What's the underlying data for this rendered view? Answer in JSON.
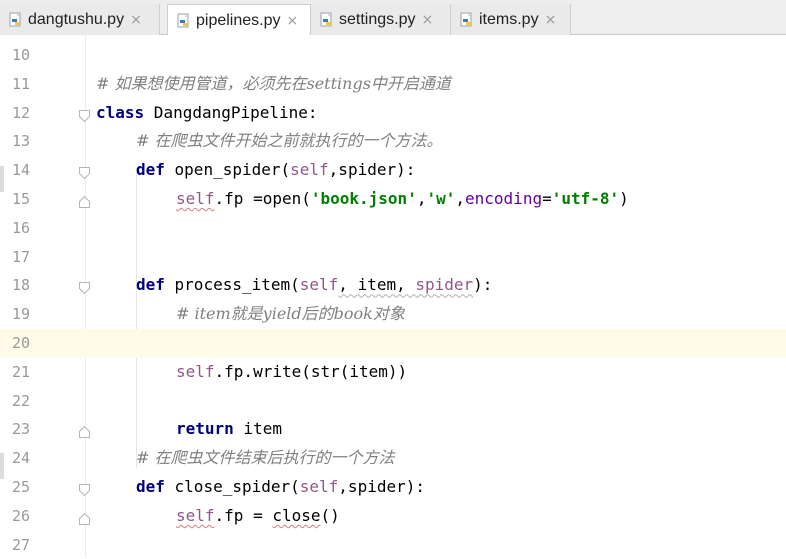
{
  "tabs": [
    {
      "label": "dangtushu.py",
      "close": "×",
      "active": false
    },
    {
      "label": "pipelines.py",
      "close": "×",
      "active": true
    },
    {
      "label": "settings.py",
      "close": "×",
      "active": false
    },
    {
      "label": "items.py",
      "close": "×",
      "active": false
    }
  ],
  "colors": {
    "keyword": "#000080",
    "comment": "#808080",
    "string": "#008000",
    "self": "#94558d",
    "current_line": "#fefbe8"
  },
  "editor": {
    "current_line": 20,
    "lines": [
      {
        "n": "10",
        "t": ""
      },
      {
        "n": "11",
        "t": "# 如果想使用管道，必须先在settings中开启通道"
      },
      {
        "n": "12",
        "t": "class DangdangPipeline:"
      },
      {
        "n": "13",
        "t": "    # 在爬虫文件开始之前就执行的一个方法。"
      },
      {
        "n": "14",
        "t": "    def open_spider(self,spider):"
      },
      {
        "n": "15",
        "t": "        self.fp =open('book.json','w',encoding='utf-8')"
      },
      {
        "n": "16",
        "t": ""
      },
      {
        "n": "17",
        "t": ""
      },
      {
        "n": "18",
        "t": "    def process_item(self, item, spider):"
      },
      {
        "n": "19",
        "t": "        # item就是yield后的book对象"
      },
      {
        "n": "20",
        "t": ""
      },
      {
        "n": "21",
        "t": "        self.fp.write(str(item))"
      },
      {
        "n": "22",
        "t": ""
      },
      {
        "n": "23",
        "t": "        return item"
      },
      {
        "n": "24",
        "t": "    # 在爬虫文件结束后执行的一个方法"
      },
      {
        "n": "25",
        "t": "    def close_spider(self,spider):"
      },
      {
        "n": "26",
        "t": "        self.fp = close()"
      },
      {
        "n": "27",
        "t": ""
      }
    ]
  },
  "tokens": {
    "l11": "# 如果想使用管道，必须先在settings中开启通道",
    "l12_kw": "class",
    "l12_name": " DangdangPipeline:",
    "l13": "# 在爬虫文件开始之前就执行的一个方法。",
    "l14_kw": "def",
    "l14_name": " open_spider(",
    "l14_self": "self",
    "l14_rest": ",spider):",
    "l15_self": "self",
    "l15_a": ".fp =open(",
    "l15_s1": "'book.json'",
    "l15_c1": ",",
    "l15_s2": "'w'",
    "l15_c2": ",",
    "l15_kwarg": "encoding",
    "l15_eq": "=",
    "l15_s3": "'utf-8'",
    "l15_end": ")",
    "l18_kw": "def",
    "l18_name": " process_item(",
    "l18_self": "self",
    "l18_rest1": ", item, ",
    "l18_spider": "spider",
    "l18_end": "):",
    "l19": "# item就是yield后的book对象",
    "l21_self": "self",
    "l21_rest": ".fp.write(str(item))",
    "l23_kw": "return",
    "l23_rest": " item",
    "l24": "# 在爬虫文件结束后执行的一个方法",
    "l25_kw": "def",
    "l25_name": " close_spider(",
    "l25_self": "self",
    "l25_rest": ",spider):",
    "l26_self": "self",
    "l26_a": ".fp = ",
    "l26_close": "close",
    "l26_end": "()"
  }
}
